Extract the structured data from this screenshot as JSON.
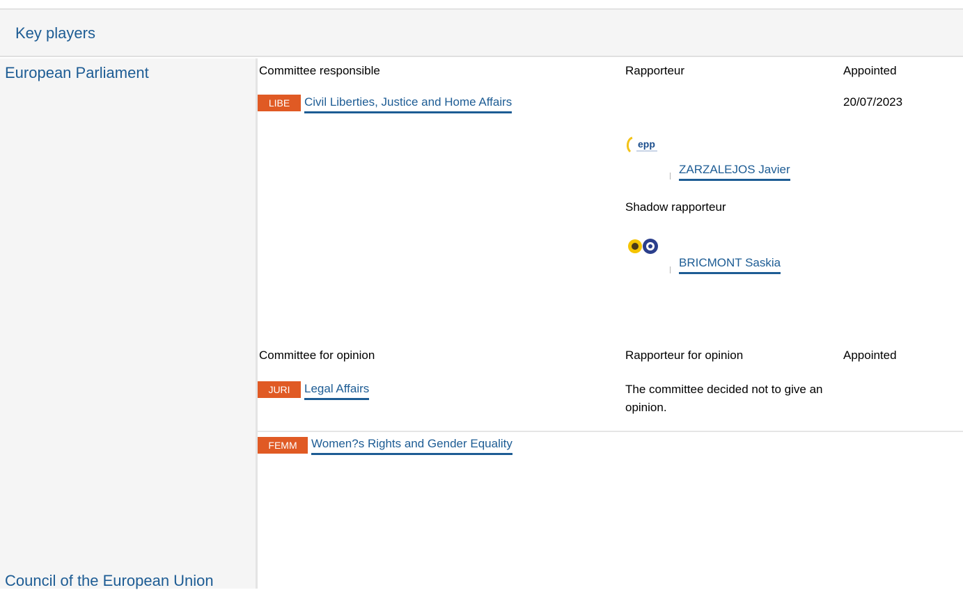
{
  "header": {
    "title": "Key players"
  },
  "sections": {
    "ep": {
      "title": "European Parliament"
    },
    "council": {
      "title": "Council of the European Union"
    }
  },
  "responsible": {
    "headers": {
      "committee": "Committee responsible",
      "rapporteur": "Rapporteur",
      "appointed": "Appointed"
    },
    "committee": {
      "code": "LIBE",
      "name": "Civil Liberties, Justice and Home Affairs",
      "appointed": "20/07/2023"
    },
    "rapporteur": {
      "name": "ZARZALEJOS Javier",
      "group_logo_text": "epp"
    },
    "shadow_label": "Shadow rapporteur",
    "shadow": {
      "name": "BRICMONT Saskia"
    }
  },
  "opinion": {
    "headers": {
      "committee": "Committee for opinion",
      "rapporteur": "Rapporteur for opinion",
      "appointed": "Appointed"
    },
    "committees": [
      {
        "code": "JURI",
        "name": "Legal Affairs",
        "note": "The committee decided not to give an opinion."
      },
      {
        "code": "FEMM",
        "name": "Women?s Rights and Gender Equality"
      }
    ]
  },
  "colors": {
    "link": "#1d5c94",
    "badge": "#e05a24",
    "panel": "#f5f5f5"
  }
}
